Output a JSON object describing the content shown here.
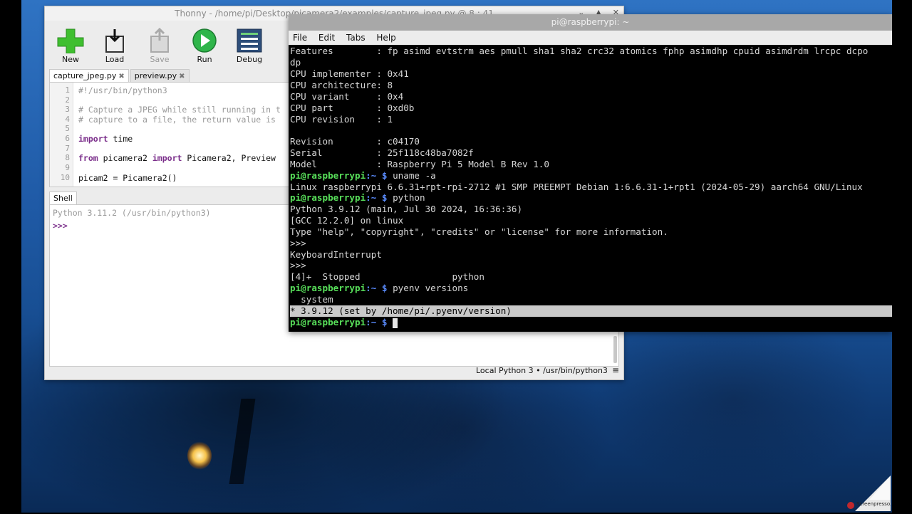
{
  "thonny": {
    "title": "Thonny  -  /home/pi/Desktop/picamera2/examples/capture_jpeg.py  @  8 : 41",
    "toolbar": {
      "new": "New",
      "load": "Load",
      "save": "Save",
      "run": "Run",
      "debug": "Debug"
    },
    "tabs": [
      "capture_jpeg.py",
      "preview.py"
    ],
    "editor_lines": [
      {
        "n": "1",
        "text": "#!/usr/bin/python3"
      },
      {
        "n": "2",
        "text": ""
      },
      {
        "n": "3",
        "text": "# Capture a JPEG while still running in t"
      },
      {
        "n": "4",
        "text": "# capture to a file, the return value is"
      },
      {
        "n": "5",
        "text": ""
      },
      {
        "n": "6",
        "kw": "import",
        "rest": " time"
      },
      {
        "n": "7",
        "text": ""
      },
      {
        "n": "8",
        "kw": "from",
        "mid": " picamera2 ",
        "kw2": "import",
        "rest": " Picamera2, Preview"
      },
      {
        "n": "9",
        "text": ""
      },
      {
        "n": "10",
        "text": "picam2 = Picamera2()"
      }
    ],
    "shell_tab": "Shell",
    "shell_version": "Python 3.11.2 (/usr/bin/python3)",
    "shell_prompt": ">>>",
    "status_interpreter": "Local Python 3  •  /usr/bin/python3",
    "status_menu": "≡"
  },
  "terminal": {
    "title": "pi@raspberrypi: ~",
    "menu": [
      "File",
      "Edit",
      "Tabs",
      "Help"
    ],
    "lines": [
      {
        "type": "text",
        "text": "Features        : fp asimd evtstrm aes pmull sha1 sha2 crc32 atomics fphp asimdhp cpuid asimdrdm lrcpc dcpo"
      },
      {
        "type": "text",
        "text": "dp"
      },
      {
        "type": "text",
        "text": "CPU implementer : 0x41"
      },
      {
        "type": "text",
        "text": "CPU architecture: 8"
      },
      {
        "type": "text",
        "text": "CPU variant     : 0x4"
      },
      {
        "type": "text",
        "text": "CPU part        : 0xd0b"
      },
      {
        "type": "text",
        "text": "CPU revision    : 1"
      },
      {
        "type": "text",
        "text": ""
      },
      {
        "type": "text",
        "text": "Revision        : c04170"
      },
      {
        "type": "text",
        "text": "Serial          : 25f118c48ba7082f"
      },
      {
        "type": "text",
        "text": "Model           : Raspberry Pi 5 Model B Rev 1.0"
      },
      {
        "type": "prompt",
        "user": "pi@raspberrypi",
        "path": ":~ $",
        "cmd": " uname -a"
      },
      {
        "type": "text",
        "text": "Linux raspberrypi 6.6.31+rpt-rpi-2712 #1 SMP PREEMPT Debian 1:6.6.31-1+rpt1 (2024-05-29) aarch64 GNU/Linux"
      },
      {
        "type": "prompt",
        "user": "pi@raspberrypi",
        "path": ":~ $",
        "cmd": " python"
      },
      {
        "type": "text",
        "text": "Python 3.9.12 (main, Jul 30 2024, 16:36:36)"
      },
      {
        "type": "text",
        "text": "[GCC 12.2.0] on linux"
      },
      {
        "type": "text",
        "text": "Type \"help\", \"copyright\", \"credits\" or \"license\" for more information."
      },
      {
        "type": "text",
        "text": ">>>"
      },
      {
        "type": "text",
        "text": "KeyboardInterrupt"
      },
      {
        "type": "text",
        "text": ">>>"
      },
      {
        "type": "text",
        "text": "[4]+  Stopped                 python"
      },
      {
        "type": "prompt",
        "user": "pi@raspberrypi",
        "path": ":~ $",
        "cmd": " pyenv versions"
      },
      {
        "type": "text",
        "text": "  system"
      },
      {
        "type": "highlight",
        "text": "* 3.9.12 (set by /home/pi/.pyenv/version) "
      },
      {
        "type": "prompt_cursor",
        "user": "pi@raspberrypi",
        "path": ":~ $",
        "cmd": " "
      }
    ]
  },
  "watermark": "Screenpresso.com"
}
